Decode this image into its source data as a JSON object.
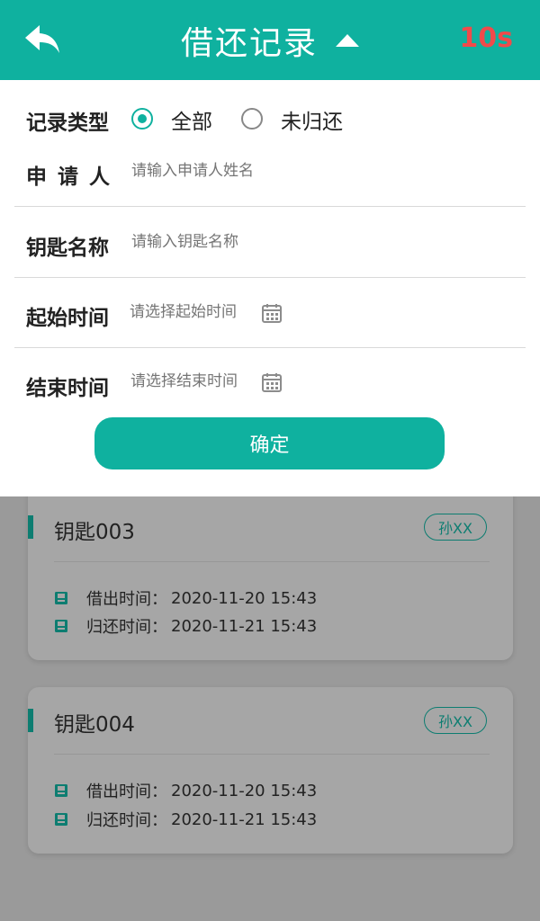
{
  "header": {
    "title": "借还记录",
    "timer": "10s",
    "accent_color": "#0fb19f",
    "timer_color": "#f04a4a",
    "back_icon": "reply-arrow-icon",
    "caret_icon": "caret-up-icon"
  },
  "filter": {
    "type_label": "记录类型",
    "options": [
      {
        "label": "全部",
        "selected": true
      },
      {
        "label": "未归还",
        "selected": false
      }
    ],
    "applicant_label": "申 请 人",
    "applicant_placeholder": "请输入申请人姓名",
    "key_name_label": "钥匙名称",
    "key_name_placeholder": "请输入钥匙名称",
    "start_label": "起始时间",
    "start_placeholder": "请选择起始时间",
    "end_label": "结束时间",
    "end_placeholder": "请选择结束时间",
    "calendar_icon": "calendar-icon",
    "confirm_label": "确定"
  },
  "records": [
    {
      "name": "钥匙003",
      "applicant": "孙XX",
      "borrow_label": "借出时间：",
      "borrow_time": "2020-11-20 15:43",
      "return_label": "归还时间：",
      "return_time": "2020-11-21 15:43"
    },
    {
      "name": "钥匙004",
      "applicant": "孙XX",
      "borrow_label": "借出时间：",
      "borrow_time": "2020-11-20 15:43",
      "return_label": "归还时间：",
      "return_time": "2020-11-21 15:43"
    }
  ]
}
